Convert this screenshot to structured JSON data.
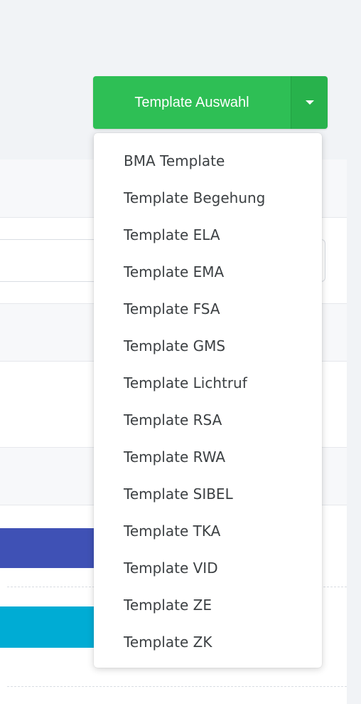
{
  "template_button": {
    "label": "Template Auswahl",
    "color": "#2ebf55"
  },
  "dropdown": {
    "items": [
      {
        "label": "BMA Template"
      },
      {
        "label": "Template Begehung"
      },
      {
        "label": "Template ELA"
      },
      {
        "label": "Template EMA"
      },
      {
        "label": "Template FSA"
      },
      {
        "label": "Template GMS"
      },
      {
        "label": "Template Lichtruf"
      },
      {
        "label": "Template RSA"
      },
      {
        "label": "Template RWA"
      },
      {
        "label": "Template SIBEL"
      },
      {
        "label": "Template TKA"
      },
      {
        "label": "Template VID"
      },
      {
        "label": "Template ZE"
      },
      {
        "label": "Template ZK"
      }
    ]
  },
  "colors": {
    "primary_bar": "#3f51b5",
    "info_bar": "#00acd4"
  }
}
